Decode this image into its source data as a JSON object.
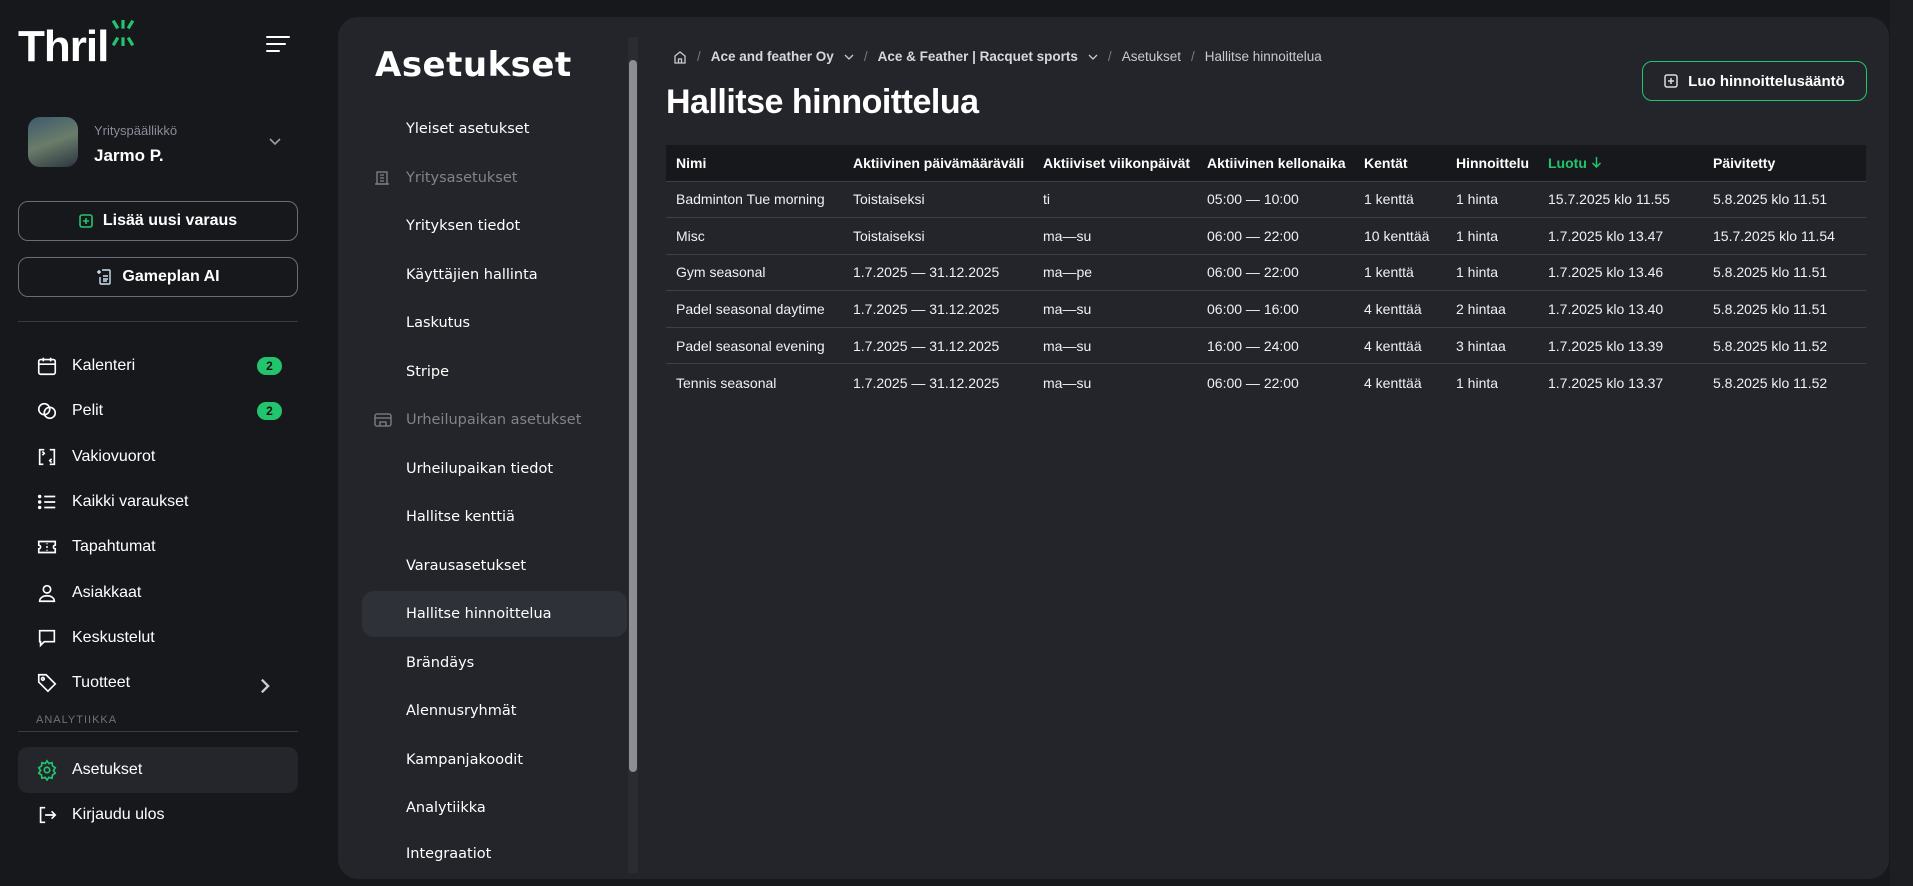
{
  "app": {
    "logo": "Thril",
    "accent": "#22c56e"
  },
  "user": {
    "role": "Yrityspäällikkö",
    "name": "Jarmo P."
  },
  "sidebar": {
    "new_booking": "Lisää uusi varaus",
    "gameplan": "Gameplan AI",
    "items": [
      {
        "label": "Kalenteri",
        "icon": "calendar-icon",
        "badge": "2"
      },
      {
        "label": "Pelit",
        "icon": "games-icon",
        "badge": "2"
      },
      {
        "label": "Vakiovuorot",
        "icon": "recurring-icon"
      },
      {
        "label": "Kaikki varaukset",
        "icon": "list-icon"
      },
      {
        "label": "Tapahtumat",
        "icon": "ticket-icon"
      },
      {
        "label": "Asiakkaat",
        "icon": "user-icon"
      },
      {
        "label": "Keskustelut",
        "icon": "chat-icon"
      },
      {
        "label": "Tuotteet",
        "icon": "tag-icon"
      }
    ],
    "section": "ANALYTIIKKA",
    "settings": "Asetukset",
    "logout": "Kirjaudu ulos"
  },
  "settings_menu": {
    "title": "Asetukset",
    "items": [
      {
        "label": "Yleiset asetukset"
      },
      {
        "label": "Yritysasetukset",
        "group": true,
        "icon": "building-icon"
      },
      {
        "label": "Yrityksen tiedot"
      },
      {
        "label": "Käyttäjien hallinta"
      },
      {
        "label": "Laskutus"
      },
      {
        "label": "Stripe"
      },
      {
        "label": "Urheilupaikan asetukset",
        "group": true,
        "icon": "venue-icon"
      },
      {
        "label": "Urheilupaikan tiedot"
      },
      {
        "label": "Hallitse kenttiä"
      },
      {
        "label": "Varausasetukset"
      },
      {
        "label": "Hallitse hinnoittelua",
        "active": true
      },
      {
        "label": "Brändäys"
      },
      {
        "label": "Alennusryhmät"
      },
      {
        "label": "Kampanjakoodit"
      },
      {
        "label": "Analytiikka"
      },
      {
        "label": "Integraatiot"
      }
    ]
  },
  "breadcrumb": [
    "Ace and feather Oy",
    "Ace & Feather | Racquet sports",
    "Asetukset",
    "Hallitse hinnoittelua"
  ],
  "page": {
    "title": "Hallitse hinnoittelua",
    "create_button": "Luo hinnoittelusääntö"
  },
  "table": {
    "columns": [
      "Nimi",
      "Aktiivinen päivämääräväli",
      "Aktiiviset viikonpäivät",
      "Aktiivinen kellonaika",
      "Kentät",
      "Hinnoittelu",
      "Luotu",
      "Päivitetty"
    ],
    "sorted_column": "Luotu",
    "rows": [
      [
        "Badminton Tue morning",
        "Toistaiseksi",
        "ti",
        "05:00 — 10:00",
        "1 kenttä",
        "1 hinta",
        "15.7.2025 klo 11.55",
        "5.8.2025 klo 11.51"
      ],
      [
        "Misc",
        "Toistaiseksi",
        "ma—su",
        "06:00 — 22:00",
        "10 kenttää",
        "1 hinta",
        "1.7.2025 klo 13.47",
        "15.7.2025 klo 11.54"
      ],
      [
        "Gym seasonal",
        "1.7.2025 — 31.12.2025",
        "ma—pe",
        "06:00 — 22:00",
        "1 kenttä",
        "1 hinta",
        "1.7.2025 klo 13.46",
        "5.8.2025 klo 11.51"
      ],
      [
        "Padel seasonal daytime",
        "1.7.2025 — 31.12.2025",
        "ma—su",
        "06:00 — 16:00",
        "4 kenttää",
        "2 hintaa",
        "1.7.2025 klo 13.40",
        "5.8.2025 klo 11.51"
      ],
      [
        "Padel seasonal evening",
        "1.7.2025 — 31.12.2025",
        "ma—su",
        "16:00 — 24:00",
        "4 kenttää",
        "3 hintaa",
        "1.7.2025 klo 13.39",
        "5.8.2025 klo 11.52"
      ],
      [
        "Tennis seasonal",
        "1.7.2025 — 31.12.2025",
        "ma—su",
        "06:00 — 22:00",
        "4 kenttää",
        "1 hinta",
        "1.7.2025 klo 13.37",
        "5.8.2025 klo 11.52"
      ]
    ]
  }
}
